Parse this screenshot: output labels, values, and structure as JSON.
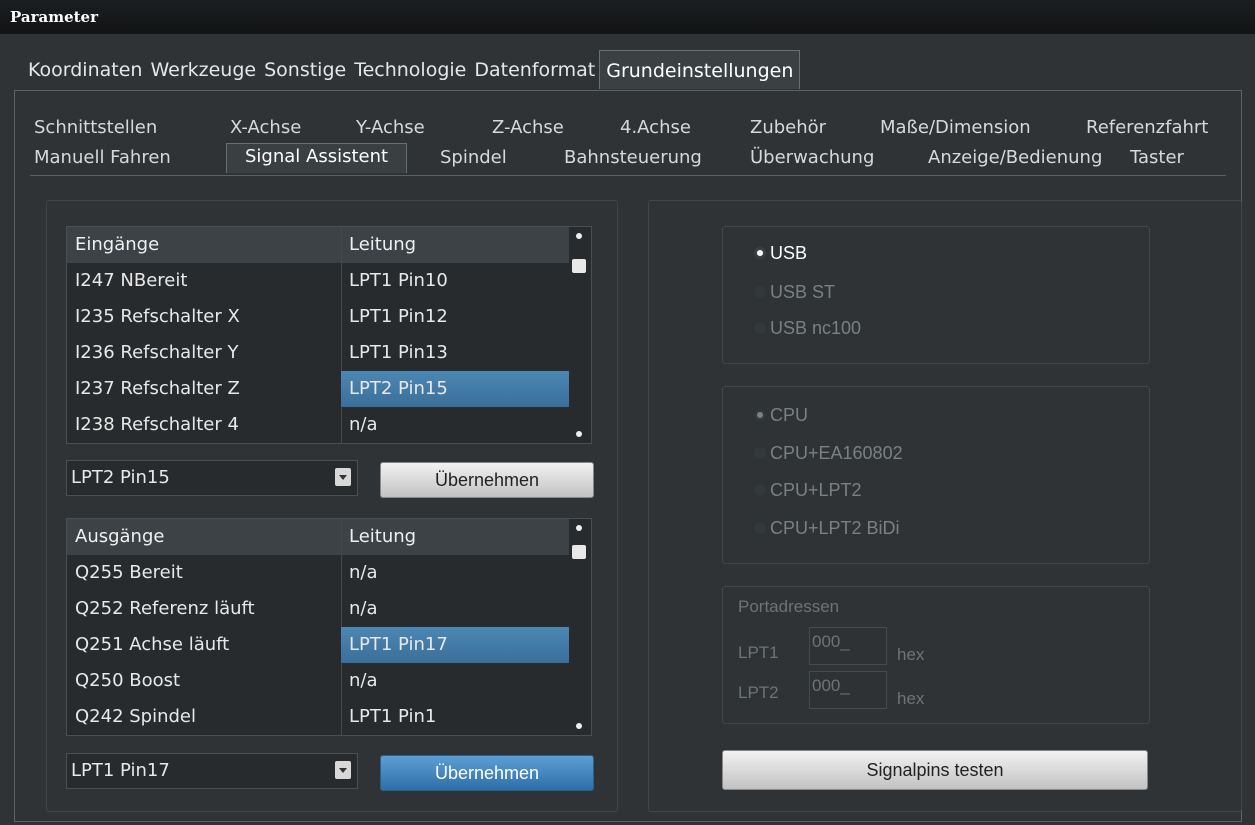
{
  "window": {
    "title": "Parameter"
  },
  "top_tabs": [
    {
      "label": "Koordinaten"
    },
    {
      "label": "Werkzeuge"
    },
    {
      "label": "Sonstige"
    },
    {
      "label": "Technologie"
    },
    {
      "label": "Datenformat"
    },
    {
      "label": "Grundeinstellungen",
      "active": true
    }
  ],
  "sub_tabs_row1": [
    "Schnittstellen",
    "X-Achse",
    "Y-Achse",
    "Z-Achse",
    "4.Achse",
    "Zubehör",
    "Maße/Dimension",
    "Referenzfahrt"
  ],
  "sub_tabs_row2": [
    "Manuell Fahren",
    "Signal Assistent",
    "Spindel",
    "Bahnsteuerung",
    "Überwachung",
    "Anzeige/Bedienung",
    "Taster"
  ],
  "inputs_table": {
    "headers": [
      "Eingänge",
      "Leitung"
    ],
    "rows": [
      [
        "I247 NBereit",
        "LPT1 Pin10"
      ],
      [
        "I235 Refschalter X",
        "LPT1 Pin12"
      ],
      [
        "I236 Refschalter Y",
        "LPT1 Pin13"
      ],
      [
        "I237 Refschalter Z",
        "LPT2 Pin15"
      ],
      [
        "I238 Refschalter 4",
        "n/a"
      ]
    ],
    "selected_row": 3,
    "combo_value": "LPT2 Pin15",
    "apply_label": "Übernehmen"
  },
  "outputs_table": {
    "headers": [
      "Ausgänge",
      "Leitung"
    ],
    "rows": [
      [
        "Q255 Bereit",
        "n/a"
      ],
      [
        "Q252 Referenz läuft",
        "n/a"
      ],
      [
        "Q251 Achse läuft",
        "LPT1 Pin17"
      ],
      [
        "Q250 Boost",
        "n/a"
      ],
      [
        "Q242 Spindel",
        "LPT1 Pin1"
      ]
    ],
    "selected_row": 2,
    "combo_value": "LPT1 Pin17",
    "apply_label": "Übernehmen"
  },
  "interface_group": {
    "options": [
      "USB",
      "USB ST",
      "USB nc100"
    ],
    "selected": "USB"
  },
  "cpu_group": {
    "options": [
      "CPU",
      "CPU+EA160802",
      "CPU+LPT2",
      "CPU+LPT2 BiDi"
    ],
    "selected": "CPU"
  },
  "ports": {
    "title": "Portadressen",
    "lpt1_label": "LPT1",
    "lpt1_value": "000_",
    "lpt2_label": "LPT2",
    "lpt2_value": "000_",
    "unit": "hex"
  },
  "test_button": "Signalpins testen"
}
